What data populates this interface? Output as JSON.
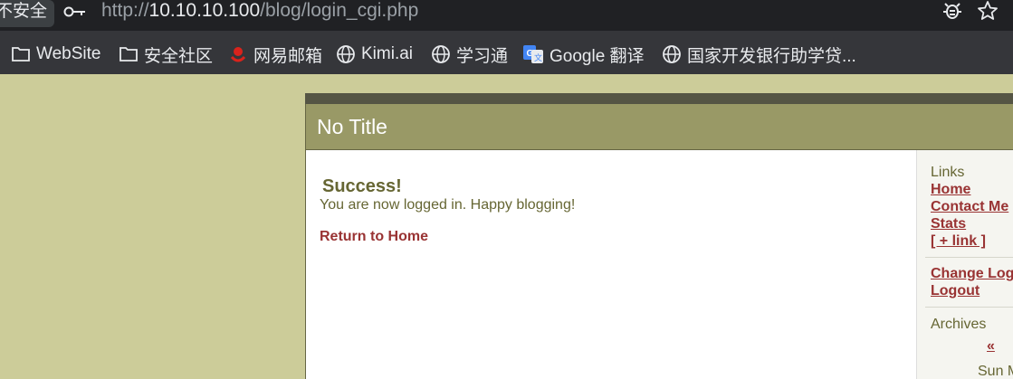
{
  "browser": {
    "security_label": "不安全",
    "url_prefix": "http://",
    "url_host": "10.10.10.100",
    "url_path": "/blog/login_cgi.php"
  },
  "bookmarks": [
    {
      "label": "WebSite",
      "icon": "folder-icon"
    },
    {
      "label": "安全社区",
      "icon": "folder-icon"
    },
    {
      "label": "网易邮箱",
      "icon": "netease-mail-icon"
    },
    {
      "label": "Kimi.ai",
      "icon": "globe-icon"
    },
    {
      "label": "学习通",
      "icon": "globe-icon"
    },
    {
      "label": "Google 翻译",
      "icon": "google-translate-icon"
    },
    {
      "label": "国家开发银行助学贷...",
      "icon": "globe-icon"
    }
  ],
  "page": {
    "header_title": "No Title",
    "success_heading": "Success!",
    "message": "You are now logged in. Happy blogging!",
    "return_link": "Return to Home"
  },
  "sidebar": {
    "links_heading": "Links",
    "links": [
      "Home",
      "Contact Me",
      "Stats",
      "[ + link ]"
    ],
    "account_links": [
      "Change Log",
      "Logout"
    ],
    "archives_heading": "Archives",
    "archives_prev": "«",
    "calendar_fragment": "Sun M"
  },
  "colors": {
    "page_background": "#cccc99",
    "header_background": "#999966",
    "link_color": "#993333",
    "text_color": "#666633"
  }
}
